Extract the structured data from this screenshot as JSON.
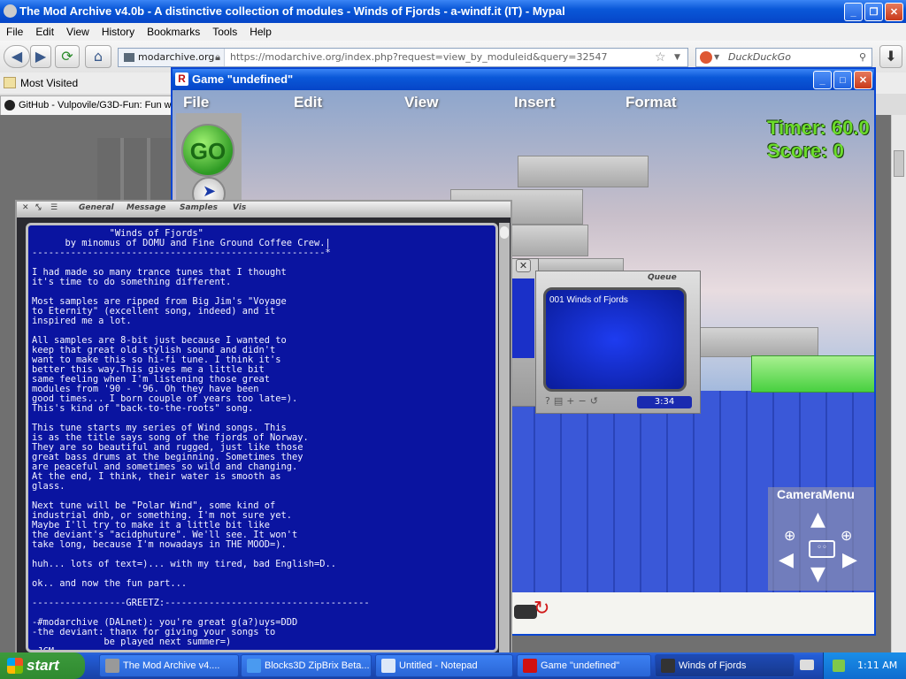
{
  "browser": {
    "title": "The Mod Archive v4.0b - A distinctive collection of modules - Winds of Fjords - a-windf.it (IT) - Mypal",
    "menu": [
      "File",
      "Edit",
      "View",
      "History",
      "Bookmarks",
      "Tools",
      "Help"
    ],
    "identity": "modarchive.org",
    "url": "https://modarchive.org/index.php?request=view_by_moduleid&query=32547",
    "search_placeholder": "DuckDuckGo",
    "bookmark": "Most Visited",
    "tab": "GitHub - Vulpovile/G3D-Fun: Fun wi"
  },
  "game": {
    "title": "Game \"undefined\"",
    "menu": [
      "File",
      "Edit",
      "View",
      "Insert",
      "Format"
    ],
    "timer": "Timer: 60.0",
    "score": "Score: 0",
    "go_label": "GO",
    "camera_menu": "CameraMenu"
  },
  "player": {
    "tabs": [
      "General",
      "Message",
      "Samples",
      "Vis"
    ],
    "text": "              \"Winds of Fjords\"\n      by minomus of DOMU and Fine Ground Coffee Crew.|\n-----------------------------------------------------*\n\nI had made so many trance tunes that I thought\nit's time to do something different.\n\nMost samples are ripped from Big Jim's \"Voyage\nto Eternity\" (excellent song, indeed) and it\ninspired me a lot.\n\nAll samples are 8-bit just because I wanted to\nkeep that great old stylish sound and didn't\nwant to make this so hi-fi tune. I think it's\nbetter this way.This gives me a little bit\nsame feeling when I'm listening those great\nmodules from '90 - '96. Oh they have been\ngood times... I born couple of years too late=).\nThis's kind of \"back-to-the-roots\" song.\n\nThis tune starts my series of Wind songs. This\nis as the title says song of the fjords of Norway.\nThey are so beautiful and rugged, just like those\ngreat bass drums at the beginning. Sometimes they\nare peaceful and sometimes so wild and changing.\nAt the end, I think, their water is smooth as\nglass.\n\nNext tune will be \"Polar Wind\", some kind of\nindustrial dnb, or something. I'm not sure yet.\nMaybe I'll try to make it a little bit like\nthe deviant's \"acidphuture\". We'll see. It won't\ntake long, because I'm nowadays in THE MOOD=).\n\nhuh... lots of text=)... with my tired, bad English=D..\n\nok.. and now the fun part...\n\n-----------------GREETZ:-------------------------------------\n\n-#modarchive (DALnet): you're great g(a?)uys=DDD\n-the deviant: thanx for giving your songs to\n             be played next summer=)\n=JCM"
  },
  "queue": {
    "label": "Queue",
    "item": "001 Winds of Fjords",
    "time": "3:34"
  },
  "taskbar": {
    "start": "start",
    "tasks": [
      "The Mod Archive v4....",
      "Blocks3D ZipBrix Beta...",
      "Untitled - Notepad",
      "Game \"undefined\"",
      "Winds of Fjords"
    ],
    "clock": "1:11 AM"
  }
}
